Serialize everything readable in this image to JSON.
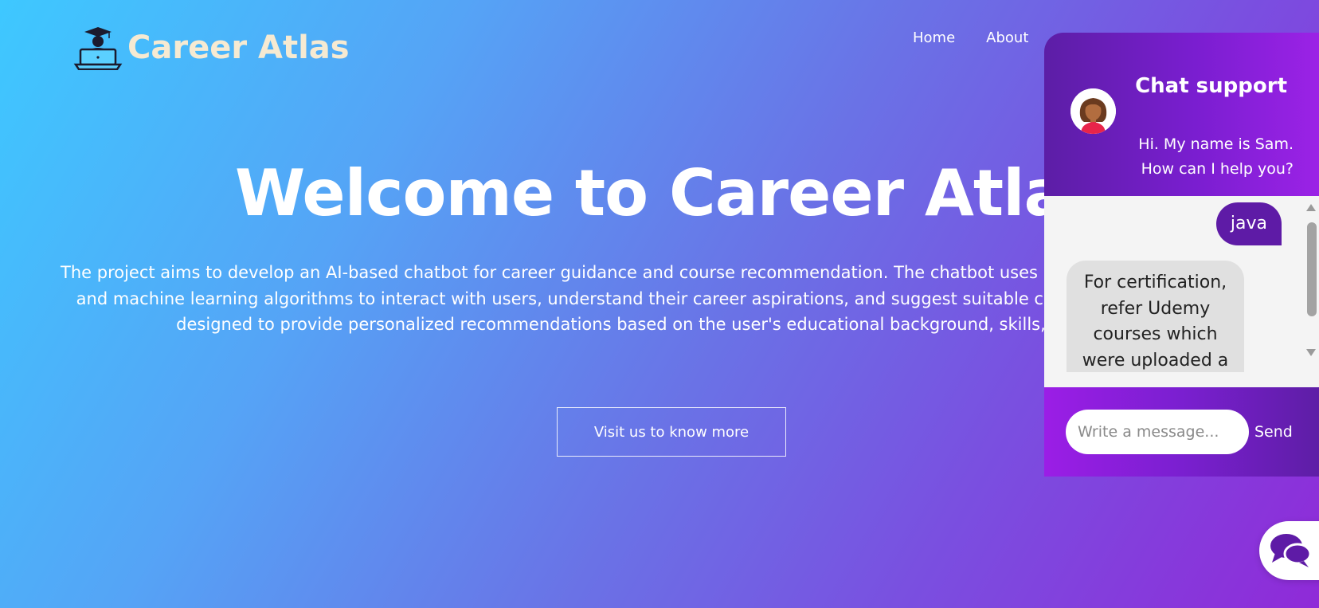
{
  "brand": {
    "name": "Career Atlas",
    "logo_icon": "graduate-laptop-icon"
  },
  "nav": {
    "items": [
      {
        "label": "Home"
      },
      {
        "label": "About"
      }
    ]
  },
  "hero": {
    "title": "Welcome to Career Atlas",
    "description": "The project aims to develop an AI-based chatbot for career guidance and course recommendation. The chatbot uses natural language processing and machine learning algorithms to interact with users, understand their career aspirations, and suggest suitable career paths. The system is designed to provide personalized recommendations based on the user's educational background, skills, and interests.",
    "cta_label": "Visit us to know more"
  },
  "chat": {
    "title": "Chat support",
    "greeting_line1": "Hi. My name is Sam.",
    "greeting_line2": "How can I help you?",
    "avatar_icon": "support-agent-avatar-icon",
    "messages": [
      {
        "sender": "user",
        "text": "java"
      },
      {
        "sender": "bot",
        "text": "For certification, refer Udemy courses which were uploaded a"
      }
    ],
    "input_placeholder": "Write a message...",
    "send_label": "Send",
    "toggle_icon": "chat-bubbles-icon"
  },
  "colors": {
    "gradient_start": "#3ec8ff",
    "gradient_end": "#8f2ad8",
    "chat_header": "#6a1ec0",
    "user_bubble": "#5e1ba6",
    "bot_bubble": "#e0e0e0",
    "logo_text": "#f6ead2"
  }
}
